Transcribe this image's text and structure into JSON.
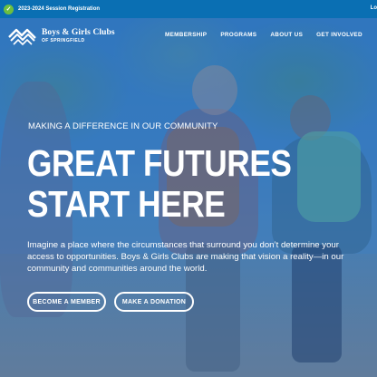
{
  "topbar": {
    "registration_text": "2023-2024 Session Registration",
    "registration_icon": "clipboard-icon",
    "login_text": "Lo"
  },
  "header": {
    "logo_line1": "Boys & Girls Clubs",
    "logo_line2": "OF SPRINGFIELD",
    "nav": [
      {
        "label": "MEMBERSHIP"
      },
      {
        "label": "PROGRAMS"
      },
      {
        "label": "ABOUT US"
      },
      {
        "label": "GET INVOLVED"
      }
    ]
  },
  "hero": {
    "tagline": "MAKING A DIFFERENCE IN OUR COMMUNITY",
    "headline_line1": "GREAT FUTURES",
    "headline_line2": "START HERE",
    "lede": "Imagine a place where the circumstances that surround you don’t determine your access to opportunities. Boys & Girls Clubs are making that vision a reality—in our community and communities around the world.",
    "primary_button": "BECOME A MEMBER",
    "secondary_button": "MAKE A DONATION"
  },
  "colors": {
    "topbar": "#0a6fb3",
    "overlay": "#145aaa",
    "registration_icon": "#6cbf3f"
  }
}
